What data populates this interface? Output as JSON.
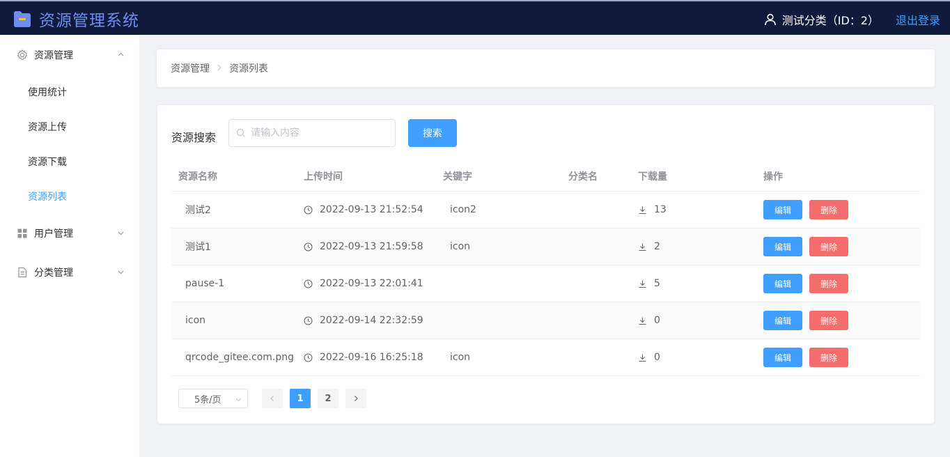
{
  "app": {
    "title": "资源管理系统"
  },
  "header": {
    "user_label": "测试分类（ID：2）",
    "logout_label": "退出登录"
  },
  "sidebar": {
    "groups": [
      {
        "label": "资源管理",
        "icon": "gear-icon",
        "expanded": true
      },
      {
        "label": "用户管理",
        "icon": "grid-icon",
        "expanded": false
      },
      {
        "label": "分类管理",
        "icon": "document-icon",
        "expanded": false
      }
    ],
    "items": [
      {
        "label": "使用统计"
      },
      {
        "label": "资源上传"
      },
      {
        "label": "资源下载"
      },
      {
        "label": "资源列表",
        "active": true
      }
    ]
  },
  "breadcrumb": {
    "root": "资源管理",
    "current": "资源列表"
  },
  "search": {
    "label": "资源搜索",
    "placeholder": "请输入内容",
    "value": "",
    "button_label": "搜索"
  },
  "table": {
    "columns": [
      "资源名称",
      "上传时间",
      "关键字",
      "分类名",
      "下载量",
      "操作"
    ],
    "rows": [
      {
        "name": "测试2",
        "time": "2022-09-13 21:52:54",
        "keyword": "icon2",
        "category": "",
        "downloads": "13"
      },
      {
        "name": "测试1",
        "time": "2022-09-13 21:59:58",
        "keyword": "icon",
        "category": "",
        "downloads": "2"
      },
      {
        "name": "pause-1",
        "time": "2022-09-13 22:01:41",
        "keyword": "",
        "category": "",
        "downloads": "5"
      },
      {
        "name": "icon",
        "time": "2022-09-14 22:32:59",
        "keyword": "",
        "category": "",
        "downloads": "0"
      },
      {
        "name": "qrcode_gitee.com.png",
        "time": "2022-09-16 16:25:18",
        "keyword": "icon",
        "category": "",
        "downloads": "0"
      }
    ],
    "edit_label": "编辑",
    "delete_label": "删除"
  },
  "pagination": {
    "page_size": "5条/页",
    "pages": [
      "1",
      "2"
    ],
    "current": "1"
  },
  "colors": {
    "header_bg": "#0f1a3c",
    "accent": "#409eff",
    "danger": "#f56c6c",
    "logo": "#6f8df0"
  }
}
